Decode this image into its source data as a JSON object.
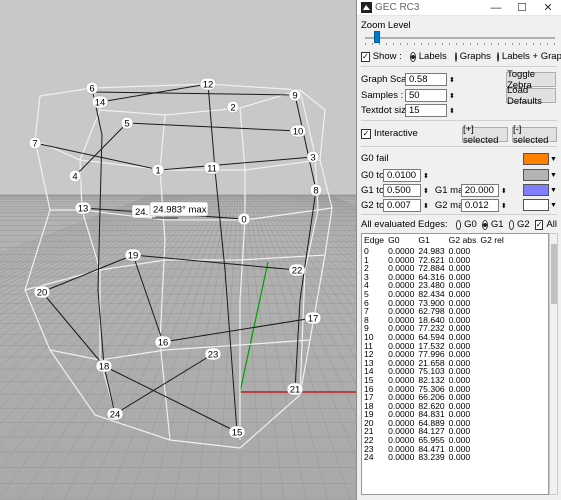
{
  "window": {
    "title": "GEC RC3",
    "minimize": "—",
    "maximize": "☐",
    "close": "✕"
  },
  "zoom": {
    "label": "Zoom Level",
    "level": 0.05
  },
  "show": {
    "checkbox_label": "Show :",
    "checked": true,
    "options": [
      "Labels",
      "Graphs",
      "Labels + Graphs"
    ],
    "selected": "Labels"
  },
  "settings": {
    "graph_scale_label": "Graph Scale :",
    "graph_scale": "0.58",
    "samples_label": "Samples :",
    "samples": "50",
    "textdot_label": "Textdot size:",
    "textdot": "15"
  },
  "buttons": {
    "toggle_zebra": "Toggle Zebra",
    "load_defaults": "Load Defaults",
    "plus_selected": "[+] selected",
    "minus_selected": "[-] selected"
  },
  "interactive": {
    "label": "Interactive",
    "checked": true
  },
  "tolerances": {
    "g0_fail_label": "G0 fail",
    "g0_fail_color": "#ff7f00",
    "g0_tol_label": "G0 tol",
    "g0_tol": "0.0100",
    "g0_tol_color": "#b4b4b4",
    "g1_tol_label": "G1 tol",
    "g1_tol": "0.500",
    "g1_max_label": "G1 max",
    "g1_max": "20.000",
    "g1_max_color": "#8080ff",
    "g2_tol_label": "G2 tol",
    "g2_tol": "0.007",
    "g2_max_label": "G2 max",
    "g2_max": "0.012",
    "g2_max_color": "#ffffff"
  },
  "evaluated": {
    "label": "All evaluated Edges:",
    "options": [
      "G0",
      "G1",
      "G2"
    ],
    "selected": "G1",
    "all_label": "All",
    "all_checked": true
  },
  "table": {
    "headers": [
      "Edge",
      "G0",
      "G1",
      "G2 abs",
      "G2 rel"
    ],
    "rows": [
      [
        "0",
        "0.0000",
        "24.983",
        "0.000",
        ""
      ],
      [
        "1",
        "0.0000",
        "72.621",
        "0.000",
        ""
      ],
      [
        "2",
        "0.0000",
        "72.884",
        "0.000",
        ""
      ],
      [
        "3",
        "0.0000",
        "64.316",
        "0.000",
        ""
      ],
      [
        "4",
        "0.0000",
        "23.480",
        "0.000",
        ""
      ],
      [
        "5",
        "0.0000",
        "82.434",
        "0.000",
        ""
      ],
      [
        "6",
        "0.0000",
        "73.900",
        "0.000",
        ""
      ],
      [
        "7",
        "0.0000",
        "62.798",
        "0.000",
        ""
      ],
      [
        "8",
        "0.0000",
        "18.640",
        "0.000",
        ""
      ],
      [
        "9",
        "0.0000",
        "77.232",
        "0.000",
        ""
      ],
      [
        "10",
        "0.0000",
        "64.594",
        "0.000",
        ""
      ],
      [
        "11",
        "0.0000",
        "17.532",
        "0.000",
        ""
      ],
      [
        "12",
        "0.0000",
        "77.996",
        "0.000",
        ""
      ],
      [
        "13",
        "0.0000",
        "21.658",
        "0.000",
        ""
      ],
      [
        "14",
        "0.0000",
        "75.103",
        "0.000",
        ""
      ],
      [
        "15",
        "0.0000",
        "82.132",
        "0.000",
        ""
      ],
      [
        "16",
        "0.0000",
        "75.306",
        "0.000",
        ""
      ],
      [
        "17",
        "0.0000",
        "66.206",
        "0.000",
        ""
      ],
      [
        "18",
        "0.0000",
        "82.620",
        "0.000",
        ""
      ],
      [
        "19",
        "0.0000",
        "84.831",
        "0.000",
        ""
      ],
      [
        "20",
        "0.0000",
        "64.889",
        "0.000",
        ""
      ],
      [
        "21",
        "0.0000",
        "84.127",
        "0.000",
        ""
      ],
      [
        "22",
        "0.0000",
        "65.955",
        "0.000",
        ""
      ],
      [
        "23",
        "0.0000",
        "84.471",
        "0.000",
        ""
      ],
      [
        "24",
        "0.0000",
        "83.239",
        "0.000",
        ""
      ]
    ]
  },
  "viewport": {
    "tooltip_partial": "24.",
    "tooltip": "24.983° max",
    "edge_labels": [
      "0",
      "1",
      "2",
      "3",
      "4",
      "5",
      "6",
      "7",
      "8",
      "9",
      "10",
      "11",
      "12",
      "13",
      "14",
      "15",
      "16",
      "17",
      "18",
      "19",
      "20",
      "21",
      "22",
      "23",
      "24"
    ],
    "axis_colors": {
      "x": "#c00000",
      "y": "#00a000"
    }
  }
}
